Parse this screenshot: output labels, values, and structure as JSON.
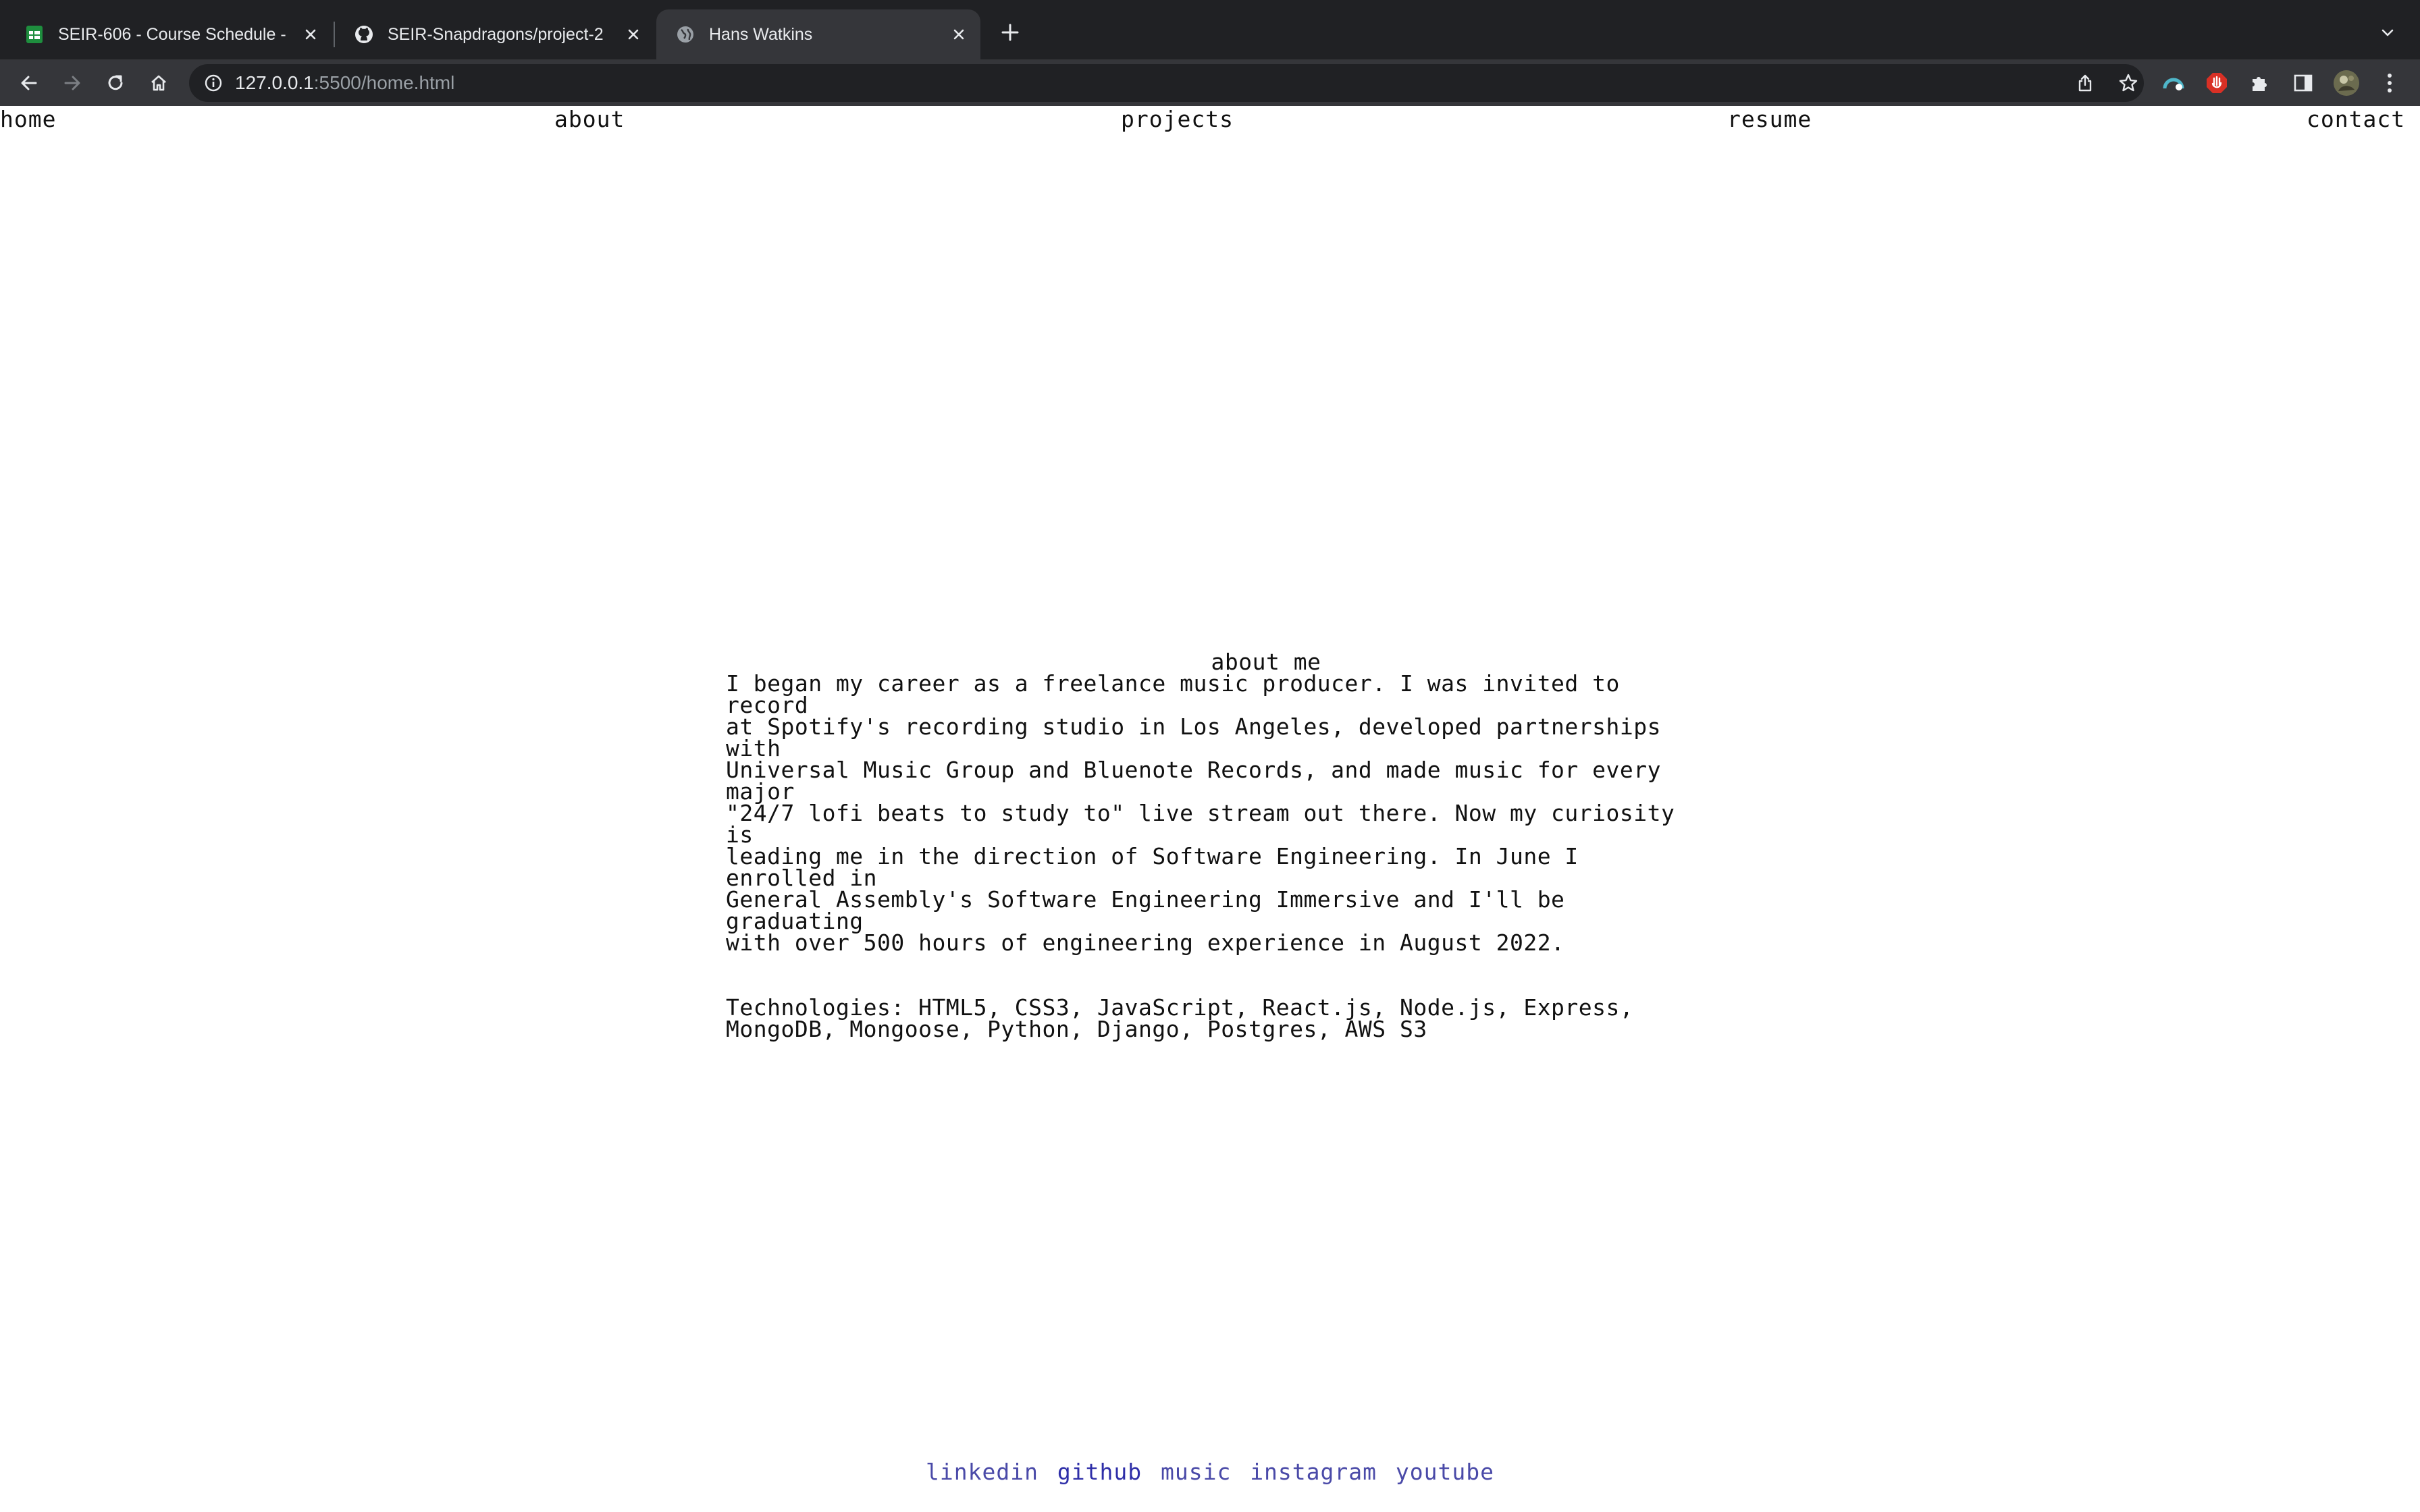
{
  "browser": {
    "tabs": [
      {
        "title": "SEIR-606 - Course Schedule -",
        "icon": "google-sheets-icon",
        "active": false
      },
      {
        "title": "SEIR-Snapdragons/project-2",
        "icon": "github-icon",
        "active": false
      },
      {
        "title": "Hans Watkins",
        "icon": "globe-icon",
        "active": true
      }
    ],
    "url_host": "127.0.0.1",
    "url_rest": ":5500/home.html"
  },
  "nav": {
    "home": "home",
    "about": "about",
    "projects": "projects",
    "resume": "resume",
    "contact": "contact"
  },
  "about": {
    "heading": "about me",
    "bio": "I began my career as a freelance music producer. I was invited to record\nat Spotify's recording studio in Los Angeles, developed partnerships with\nUniversal Music Group and Bluenote Records, and made music for every major\n\"24/7 lofi beats to study to\" live stream out there. Now my curiosity is\nleading me in the direction of Software Engineering. In June I enrolled in\nGeneral Assembly's Software Engineering Immersive and I'll be graduating\nwith over 500 hours of engineering experience in August 2022.",
    "technologies": "Technologies: HTML5, CSS3, JavaScript, React.js, Node.js, Express,\nMongoDB, Mongoose, Python, Django, Postgres, AWS S3"
  },
  "footer": {
    "linkedin": "linkedin",
    "github": "github",
    "music": "music",
    "instagram": "instagram",
    "youtube": "youtube"
  },
  "colors": {
    "chrome_bg": "#202124",
    "toolbar_bg": "#35363a",
    "link": "#4a4aa8"
  }
}
